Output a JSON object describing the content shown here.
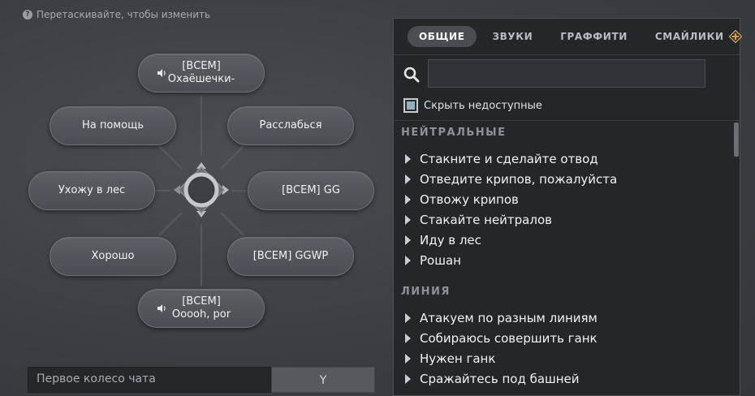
{
  "hint": {
    "text": "Перетаскивайте, чтобы изменить",
    "icon": "help-icon"
  },
  "wheel": {
    "slots": {
      "top": {
        "line1": "[ВСЕМ]",
        "line2": "Охаёшечки-",
        "sound": true
      },
      "top_left": {
        "label": "На помощь"
      },
      "top_right": {
        "label": "Расслабься"
      },
      "left": {
        "label": "Ухожу в лес"
      },
      "right": {
        "label": "[ВСЕМ] GG"
      },
      "bottom_left": {
        "label": "Хорошо"
      },
      "bottom_right": {
        "label": "[ВСЕМ] GGWP"
      },
      "bottom": {
        "line1": "[ВСЕМ]",
        "line2": "Ooooh, por",
        "sound": true
      }
    },
    "name_value": "Первое колесо чата",
    "key": "Y"
  },
  "panel": {
    "tabs": [
      {
        "label": "ОБЩИЕ",
        "active": true
      },
      {
        "label": "ЗВУКИ",
        "active": false
      },
      {
        "label": "ГРАФФИТИ",
        "active": false
      },
      {
        "label": "СМАЙЛИКИ",
        "active": false,
        "badge": "plus-badge-icon"
      }
    ],
    "search": {
      "value": "",
      "placeholder": ""
    },
    "hide_unavailable": {
      "label": "Скрыть недоступные",
      "checked": true
    },
    "sections": [
      {
        "title": "НЕЙТРАЛЬНЫЕ",
        "items": [
          "Стакните и сделайте отвод",
          "Отведите крипов, пожалуйста",
          "Отвожу крипов",
          "Стакайте нейтралов",
          "Иду в лес",
          "Рошан"
        ]
      },
      {
        "title": "ЛИНИЯ",
        "items": [
          "Атакуем по разным линиям",
          "Собираюсь совершить ганк",
          "Нужен ганк",
          "Сражайтесь под башней"
        ]
      }
    ]
  },
  "colors": {
    "accent_gold": "#c9a15a",
    "panel_bg": "#24272a",
    "pill_bg": "#52565b"
  }
}
